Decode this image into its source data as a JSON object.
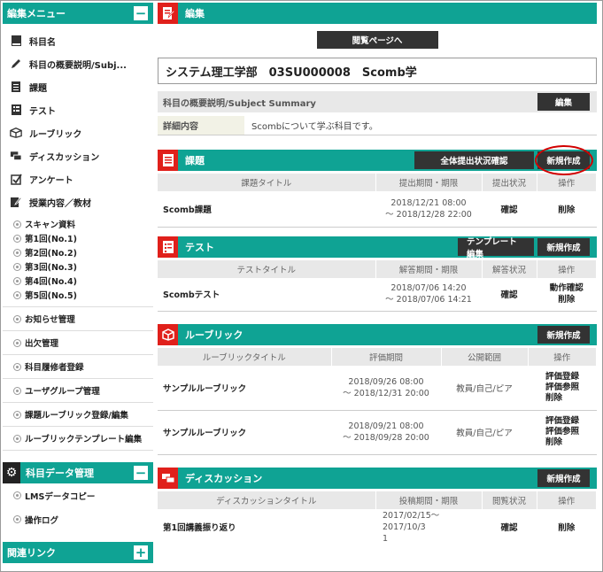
{
  "sidebar": {
    "header": "編集メニュー",
    "items": [
      "科目名",
      "科目の概要説明/Subj...",
      "課題",
      "テスト",
      "ルーブリック",
      "ディスカッション",
      "アンケート",
      "授業内容／教材"
    ],
    "sub_items": [
      "スキャン資料",
      "第1回(No.1)",
      "第2回(No.2)",
      "第3回(No.3)",
      "第4回(No.4)",
      "第5回(No.5)"
    ],
    "box_items": [
      "お知らせ管理",
      "出欠管理",
      "科目履修者登録",
      "ユーザグループ管理",
      "課題ルーブリック登録/編集",
      "ルーブリックテンプレート編集"
    ],
    "data_header": "科目データ管理",
    "data_items": [
      "LMSデータコピー",
      "操作ログ"
    ],
    "links_header": "関連リンク",
    "minus": "−",
    "plus": "+"
  },
  "main": {
    "edit": {
      "title": "編集",
      "view_button": "閲覧ページへ"
    },
    "course_title": "システム理工学部　03SU000008　Scomb学",
    "summary": {
      "title": "科目の概要説明/Subject Summary",
      "edit_button": "編集",
      "detail_label": "詳細内容",
      "detail_value": "Scombについて学ぶ科目です。"
    },
    "assignments": {
      "title": "課題",
      "buttons": [
        "全体提出状況確認",
        "新規作成"
      ],
      "headers": [
        "課題タイトル",
        "提出期間・期限",
        "提出状況",
        "操作"
      ],
      "rows": [
        {
          "title": "Scomb課題",
          "period1": "2018/12/21 08:00",
          "period2": "～ 2018/12/28 22:00",
          "status": "確認",
          "ops": [
            "削除"
          ]
        }
      ]
    },
    "tests": {
      "title": "テスト",
      "buttons": [
        "テンプレート編集",
        "新規作成"
      ],
      "headers": [
        "テストタイトル",
        "解答期間・期限",
        "解答状況",
        "操作"
      ],
      "rows": [
        {
          "title": "Scombテスト",
          "period1": "2018/07/06 14:20",
          "period2": "～ 2018/07/06 14:21",
          "status": "確認",
          "ops": [
            "動作確認",
            "削除"
          ]
        }
      ]
    },
    "rubrics": {
      "title": "ルーブリック",
      "buttons": [
        "新規作成"
      ],
      "headers": [
        "ルーブリックタイトル",
        "評価期間",
        "公開範囲",
        "操作"
      ],
      "rows": [
        {
          "title": "サンプルルーブリック",
          "period1": "2018/09/26 08:00",
          "period2": "～ 2018/12/31 20:00",
          "scope": "教員/自己/ピア",
          "ops": [
            "評価登録",
            "評価参照",
            "削除"
          ]
        },
        {
          "title": "サンプルルーブリック",
          "period1": "2018/09/21 08:00",
          "period2": "～ 2018/09/28 20:00",
          "scope": "教員/自己/ピア",
          "ops": [
            "評価登録",
            "評価参照",
            "削除"
          ]
        }
      ]
    },
    "discussions": {
      "title": "ディスカッション",
      "buttons": [
        "新規作成"
      ],
      "headers": [
        "ディスカッションタイトル",
        "投稿期間・期限",
        "閲覧状況",
        "操作"
      ],
      "rows": [
        {
          "title": "第1回講義振り返り",
          "period1": "2017/02/15～2017/10/3",
          "period2": "1",
          "status": "確認",
          "ops": [
            "削除"
          ]
        }
      ]
    }
  }
}
